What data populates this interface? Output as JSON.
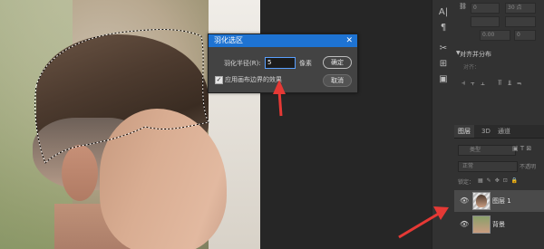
{
  "dialog": {
    "title": "羽化选区",
    "close": "✕",
    "radius_label": "羽化半径(R):",
    "radius_value": "5",
    "unit": "像素",
    "ok": "确定",
    "cancel": "取消",
    "apply_edge_checked": true,
    "apply_edge_label": "应用画布边界的效果"
  },
  "panel": {
    "align_heading": "对齐并分布",
    "align_sub": "对齐：",
    "tabs": [
      "图层",
      "3D",
      "通道"
    ],
    "active_tab": 0,
    "search_placeholder": "类型",
    "blend_mode": "正常",
    "opacity_label": "不透明",
    "lock_label": "锁定：",
    "layers": [
      {
        "name": "图层 1",
        "selected": true
      },
      {
        "name": "背景",
        "selected": false
      }
    ],
    "fields": [
      "0",
      "30 点",
      "0.00",
      "0"
    ]
  },
  "colors": {
    "accent": "#1e73d2",
    "arrow": "#e53935",
    "panel_bg": "#323232"
  }
}
